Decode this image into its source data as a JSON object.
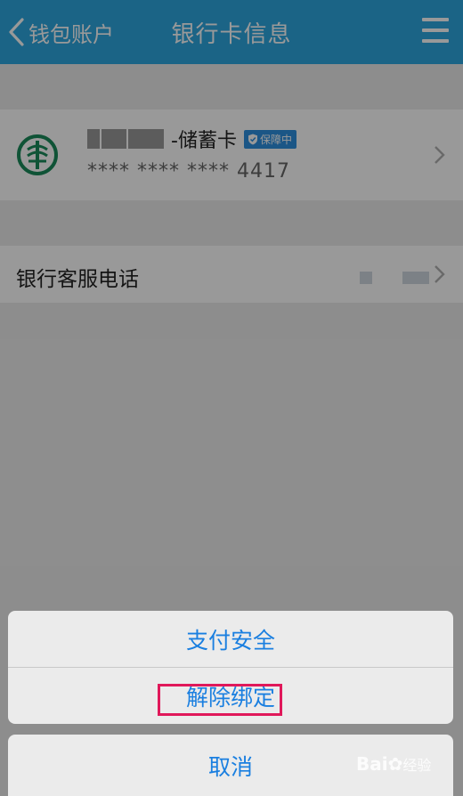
{
  "nav": {
    "back_label": "钱包账户",
    "title": "银行卡信息"
  },
  "card": {
    "type_label": "-储蓄卡",
    "protect_badge": "保障中",
    "number": "**** **** **** 4417"
  },
  "service": {
    "label": "银行客服电话"
  },
  "action_sheet": {
    "pay_security": "支付安全",
    "unbind": "解除绑定",
    "cancel": "取消"
  },
  "watermark": {
    "brand": "Bai",
    "suffix": "经验"
  },
  "colors": {
    "nav_bar": "#2ea7e0",
    "action_text": "#1a7fe0",
    "highlight": "#e0185a",
    "badge": "#2e8fe0",
    "bank_logo": "#1a8a5a"
  }
}
